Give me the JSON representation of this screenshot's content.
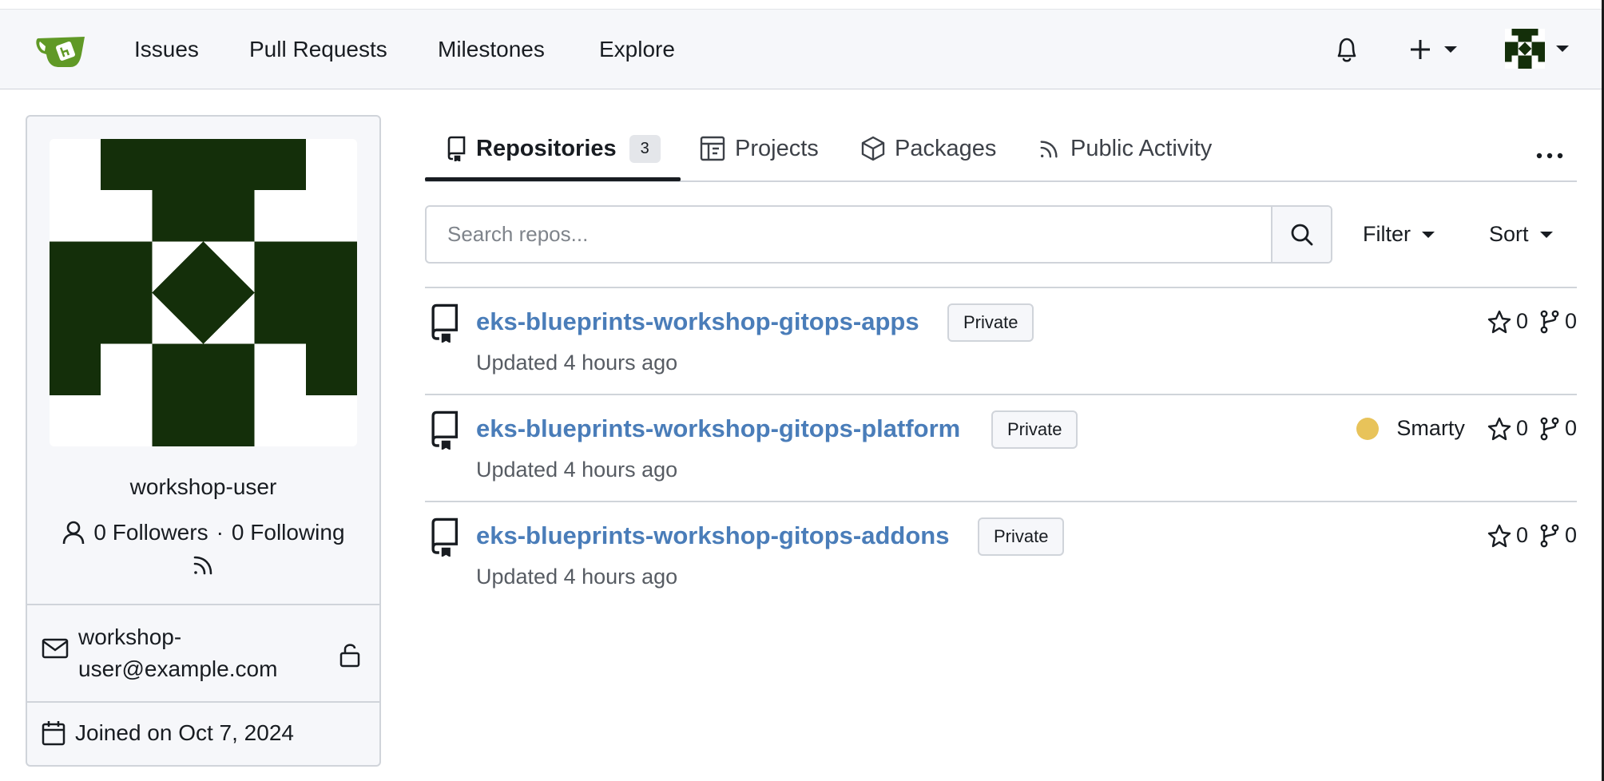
{
  "nav": {
    "links": [
      "Issues",
      "Pull Requests",
      "Milestones",
      "Explore"
    ],
    "icons": {
      "logo": "gitea-logo",
      "notifications": "bell-icon",
      "create": "plus-icon",
      "user_menu": "avatar-icon"
    }
  },
  "sidebar": {
    "username": "workshop-user",
    "followers": "0 Followers",
    "separator": "·",
    "following": "0 Following",
    "email": "workshop-user@example.com",
    "joined": "Joined on Oct 7, 2024"
  },
  "tabs": [
    {
      "label": "Repositories",
      "count": "3",
      "icon": "repo-icon",
      "active": true
    },
    {
      "label": "Projects",
      "icon": "project-icon"
    },
    {
      "label": "Packages",
      "icon": "package-icon"
    },
    {
      "label": "Public Activity",
      "icon": "rss-icon"
    }
  ],
  "search": {
    "placeholder": "Search repos..."
  },
  "filter_label": "Filter",
  "sort_label": "Sort",
  "repos": [
    {
      "name": "eks-blueprints-workshop-gitops-apps",
      "visibility": "Private",
      "updated": "Updated 4 hours ago",
      "language": "",
      "stars": "0",
      "forks": "0"
    },
    {
      "name": "eks-blueprints-workshop-gitops-platform",
      "visibility": "Private",
      "updated": "Updated 4 hours ago",
      "language": "Smarty",
      "language_color": "#e8c35a",
      "stars": "0",
      "forks": "0"
    },
    {
      "name": "eks-blueprints-workshop-gitops-addons",
      "visibility": "Private",
      "updated": "Updated 4 hours ago",
      "language": "",
      "stars": "0",
      "forks": "0"
    }
  ],
  "colors": {
    "avatar": "#142f0a",
    "link": "#4a7db9",
    "logo": "#609926"
  }
}
